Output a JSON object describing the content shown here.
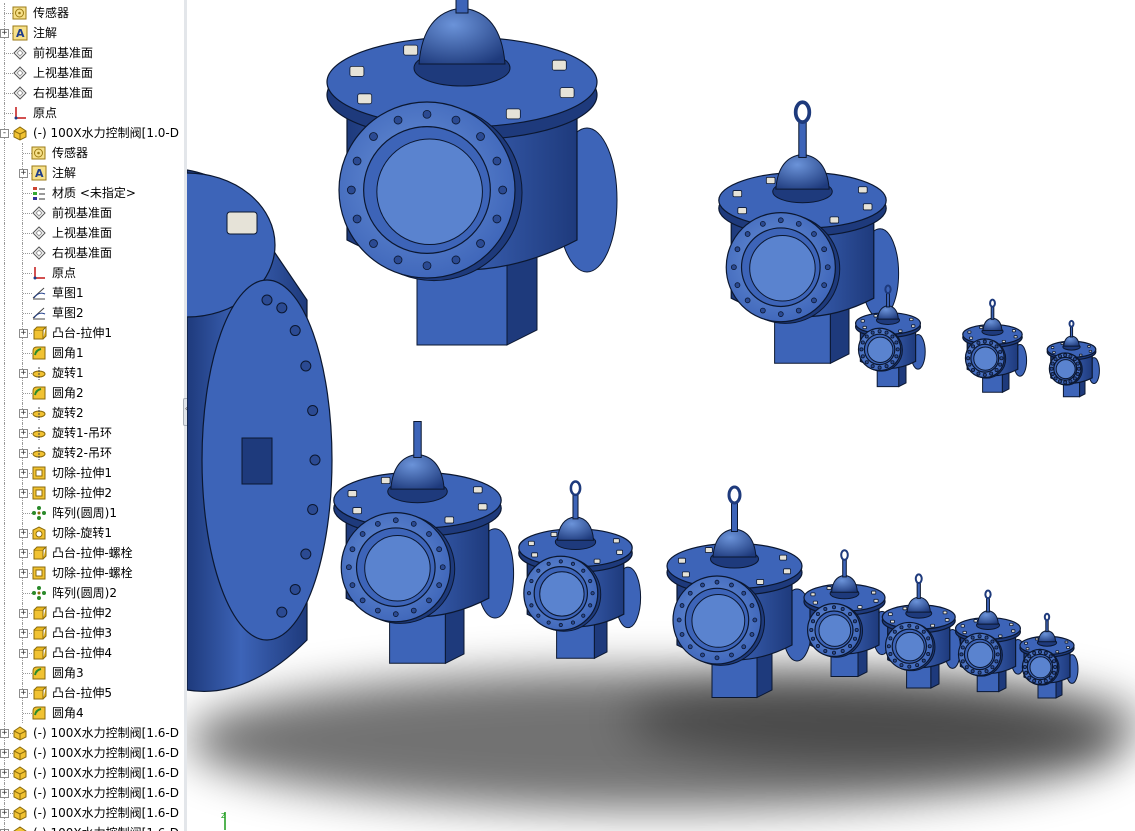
{
  "feature_tree": {
    "items": [
      {
        "label": "传感器",
        "icon": "sensor-icon",
        "indent": 0,
        "expander": ""
      },
      {
        "label": "注解",
        "icon": "annotation-icon",
        "indent": 0,
        "expander": "+"
      },
      {
        "label": "前视基准面",
        "icon": "plane-icon",
        "indent": 0,
        "expander": ""
      },
      {
        "label": "上视基准面",
        "icon": "plane-icon",
        "indent": 0,
        "expander": ""
      },
      {
        "label": "右视基准面",
        "icon": "plane-icon",
        "indent": 0,
        "expander": ""
      },
      {
        "label": "原点",
        "icon": "origin-icon",
        "indent": 0,
        "expander": ""
      },
      {
        "label": "(-) 100X水力控制阀[1.0-D",
        "icon": "part-icon",
        "indent": 0,
        "expander": "-"
      },
      {
        "label": "传感器",
        "icon": "sensor-icon",
        "indent": 1,
        "expander": ""
      },
      {
        "label": "注解",
        "icon": "annotation-icon",
        "indent": 1,
        "expander": "+"
      },
      {
        "label": "材质 <未指定>",
        "icon": "material-icon",
        "indent": 1,
        "expander": ""
      },
      {
        "label": "前视基准面",
        "icon": "plane-icon",
        "indent": 1,
        "expander": ""
      },
      {
        "label": "上视基准面",
        "icon": "plane-icon",
        "indent": 1,
        "expander": ""
      },
      {
        "label": "右视基准面",
        "icon": "plane-icon",
        "indent": 1,
        "expander": ""
      },
      {
        "label": "原点",
        "icon": "origin-icon",
        "indent": 1,
        "expander": ""
      },
      {
        "label": "草图1",
        "icon": "sketch-icon",
        "indent": 1,
        "expander": ""
      },
      {
        "label": "草图2",
        "icon": "sketch-icon",
        "indent": 1,
        "expander": ""
      },
      {
        "label": "凸台-拉伸1",
        "icon": "boss-extrude-icon",
        "indent": 1,
        "expander": "+"
      },
      {
        "label": "圆角1",
        "icon": "fillet-icon",
        "indent": 1,
        "expander": ""
      },
      {
        "label": "旋转1",
        "icon": "revolve-icon",
        "indent": 1,
        "expander": "+"
      },
      {
        "label": "圆角2",
        "icon": "fillet-icon",
        "indent": 1,
        "expander": ""
      },
      {
        "label": "旋转2",
        "icon": "revolve-icon",
        "indent": 1,
        "expander": "+"
      },
      {
        "label": "旋转1-吊环",
        "icon": "revolve-icon",
        "indent": 1,
        "expander": "+"
      },
      {
        "label": "旋转2-吊环",
        "icon": "revolve-icon",
        "indent": 1,
        "expander": "+"
      },
      {
        "label": "切除-拉伸1",
        "icon": "cut-extrude-icon",
        "indent": 1,
        "expander": "+"
      },
      {
        "label": "切除-拉伸2",
        "icon": "cut-extrude-icon",
        "indent": 1,
        "expander": "+"
      },
      {
        "label": "阵列(圆周)1",
        "icon": "circular-pattern-icon",
        "indent": 1,
        "expander": ""
      },
      {
        "label": "切除-旋转1",
        "icon": "cut-revolve-icon",
        "indent": 1,
        "expander": "+"
      },
      {
        "label": "凸台-拉伸-螺栓",
        "icon": "boss-extrude-icon",
        "indent": 1,
        "expander": "+"
      },
      {
        "label": "切除-拉伸-螺栓",
        "icon": "cut-extrude-icon",
        "indent": 1,
        "expander": "+"
      },
      {
        "label": "阵列(圆周)2",
        "icon": "circular-pattern-icon",
        "indent": 1,
        "expander": ""
      },
      {
        "label": "凸台-拉伸2",
        "icon": "boss-extrude-icon",
        "indent": 1,
        "expander": "+"
      },
      {
        "label": "凸台-拉伸3",
        "icon": "boss-extrude-icon",
        "indent": 1,
        "expander": "+"
      },
      {
        "label": "凸台-拉伸4",
        "icon": "boss-extrude-icon",
        "indent": 1,
        "expander": "+"
      },
      {
        "label": "圆角3",
        "icon": "fillet-icon",
        "indent": 1,
        "expander": ""
      },
      {
        "label": "凸台-拉伸5",
        "icon": "boss-extrude-icon",
        "indent": 1,
        "expander": "+"
      },
      {
        "label": "圆角4",
        "icon": "fillet-icon",
        "indent": 1,
        "expander": ""
      },
      {
        "label": "(-) 100X水力控制阀[1.6-D",
        "icon": "part-icon",
        "indent": 0,
        "expander": "+"
      },
      {
        "label": "(-) 100X水力控制阀[1.6-D",
        "icon": "part-icon",
        "indent": 0,
        "expander": "+"
      },
      {
        "label": "(-) 100X水力控制阀[1.6-D",
        "icon": "part-icon",
        "indent": 0,
        "expander": "+"
      },
      {
        "label": "(-) 100X水力控制阀[1.6-D",
        "icon": "part-icon",
        "indent": 0,
        "expander": "+"
      },
      {
        "label": "(-) 100X水力控制阀[1.6-D",
        "icon": "part-icon",
        "indent": 0,
        "expander": "+"
      },
      {
        "label": "(-) 100X水力控制阀[1.6-D",
        "icon": "part-icon",
        "indent": 0,
        "expander": "+"
      }
    ]
  },
  "colors": {
    "valve_body": "#3d64b8",
    "valve_dark": "#1e3a7c",
    "valve_light": "#6b93d9",
    "outline": "#0b1730",
    "bolt": "#e6e3d8",
    "tree_text": "#000000"
  },
  "panel_toggle_glyph": "‹‹",
  "triad_label": "Z"
}
